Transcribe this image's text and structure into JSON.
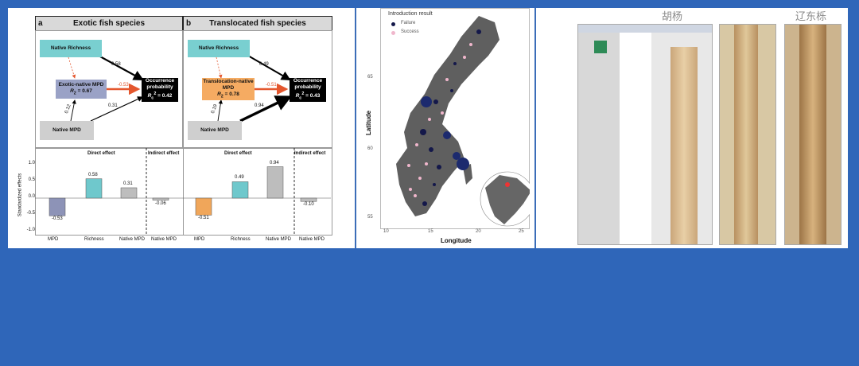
{
  "figure": {
    "panel_a": {
      "tag": "a",
      "title": "Exotic fish species",
      "native_richness": "Native Richness",
      "mid_box_line1": "Exotic-native MPD",
      "mid_box_r2": "R",
      "mid_box_r2_sub": "2",
      "mid_box_r2_val": "= 0.67",
      "native_mpd": "Native MPD",
      "occ_line1": "Occurrence",
      "occ_line2": "probability",
      "occ_r2": "R",
      "occ_r2_sub": "c",
      "occ_r2_sup": "2",
      "occ_r2_val": "= 0.42",
      "path_richness_occ": "0.58",
      "path_mpd_occ": "-0.53",
      "path_native_mid": "0.12",
      "path_native_occ": "0.31"
    },
    "panel_b": {
      "tag": "b",
      "title": "Translocated fish species",
      "native_richness": "Native Richness",
      "mid_box_line1": "Translocation-native",
      "mid_box_line2": "MPD",
      "mid_box_r2": "R",
      "mid_box_r2_sub": "2",
      "mid_box_r2_val": "= 0.78",
      "native_mpd": "Native MPD",
      "occ_line1": "Occurrence",
      "occ_line2": "probability",
      "occ_r2": "R",
      "occ_r2_sub": "c",
      "occ_r2_sup": "2",
      "occ_r2_val": "= 0.43",
      "path_richness_occ": "0.49",
      "path_mpd_occ": "-0.51",
      "path_native_mid": "0.19",
      "path_native_occ": "0.94"
    },
    "effects": {
      "ylabel": "Standardized effects",
      "direct": "Direct effect",
      "indirect": "Indirect effect",
      "yticks": [
        "1.0",
        "0.5",
        "0.0",
        "-0.5",
        "-1.0"
      ],
      "a_bars": [
        {
          "label": "MPD",
          "value": "-0.53",
          "color": "#8d93b7"
        },
        {
          "label": "Richness",
          "value": "0.58",
          "color": "#6fc8cc"
        },
        {
          "label": "Native MPD",
          "value": "0.31",
          "color": "#bdbdbd"
        },
        {
          "label": "Native MPD",
          "value": "-0.06",
          "color": "#bdbdbd"
        }
      ],
      "b_bars": [
        {
          "label": "MPD",
          "value": "-0.51",
          "color": "#f0a65a"
        },
        {
          "label": "Richness",
          "value": "0.49",
          "color": "#6fc8cc"
        },
        {
          "label": "Native MPD",
          "value": "0.94",
          "color": "#bdbdbd"
        },
        {
          "label": "Native MPD",
          "value": "-0.10",
          "color": "#bdbdbd"
        }
      ]
    }
  },
  "map": {
    "legend_title": "Introduction result",
    "legend_failure": "Failure",
    "legend_success": "Success",
    "ylabel": "Latitude",
    "xlabel": "Longitude",
    "yticks": [
      "65",
      "60",
      "55"
    ],
    "xticks": [
      "10",
      "15",
      "20",
      "25"
    ]
  },
  "software": {
    "label_1": "胡杨",
    "label_2": "辽东栎"
  }
}
